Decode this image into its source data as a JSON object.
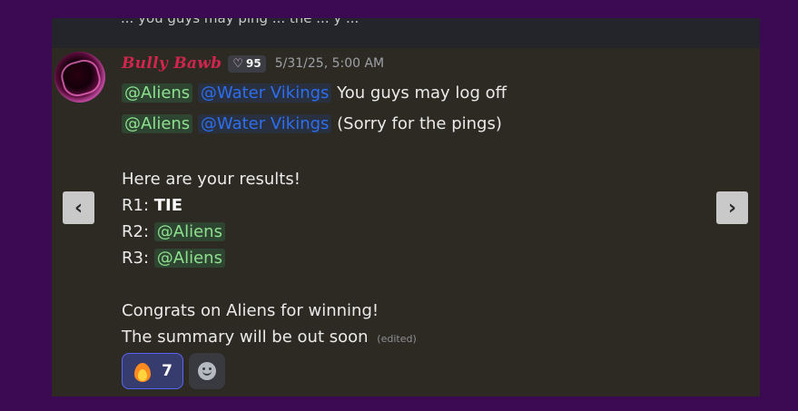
{
  "top_strip": {
    "cut_text": "... you guys may ping ... the ... y ..."
  },
  "message": {
    "username": "Bully Bawb",
    "tag": {
      "icon": "heart-icon",
      "text": "95"
    },
    "timestamp": "5/31/25, 5:00 AM",
    "line1": {
      "mention1": "@Aliens",
      "mention2": "@Water Vikings",
      "text": "You guys may log off"
    },
    "line2": {
      "mention1": "@Aliens",
      "mention2": "@Water Vikings",
      "text": "(Sorry for the pings)"
    },
    "results_header": "Here are your results!",
    "r1": {
      "label": "R1:",
      "value": "TIE"
    },
    "r2": {
      "label": "R2:",
      "mention": "@Aliens"
    },
    "r3": {
      "label": "R3:",
      "mention": "@Aliens"
    },
    "congrats": "Congrats on Aliens for winning!",
    "summary": "The summary will be out soon",
    "edited": "(edited)"
  },
  "reactions": [
    {
      "emoji": "fire-emoji",
      "count": "7"
    }
  ],
  "add_reaction": {
    "icon": "smiley-icon"
  },
  "nav": {
    "prev": "‹",
    "next": "›"
  },
  "colors": {
    "background": "#3b0a52",
    "card": "#2d2a23",
    "username": "#d0254c",
    "mention_green": "#8ee08f",
    "mention_blue": "#2d6ff0"
  }
}
